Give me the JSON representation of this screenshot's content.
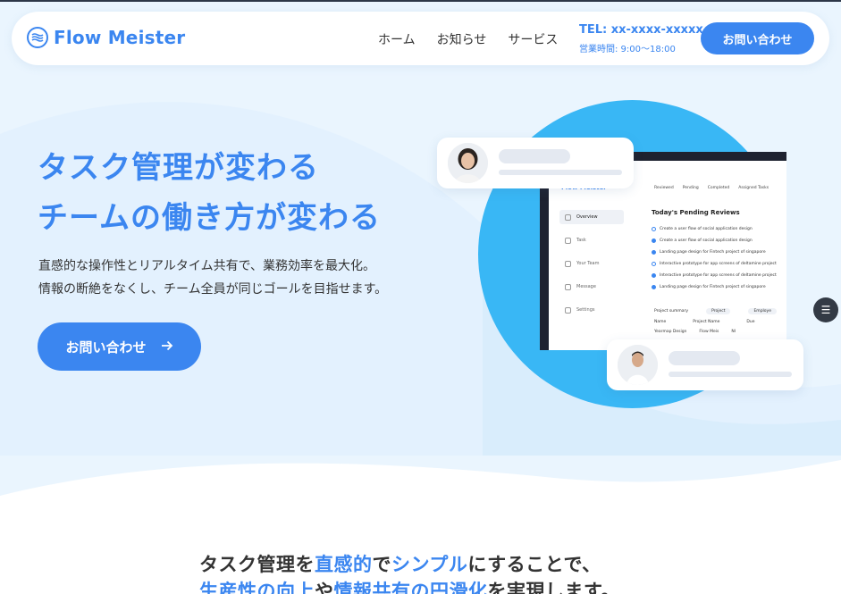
{
  "header": {
    "logo_text": "Flow Meister",
    "nav": [
      "ホーム",
      "お知らせ",
      "サービス"
    ],
    "tel": "TEL: xx-xxxx-xxxxx",
    "hours": "営業時間: 9:00〜18:00",
    "cta_label": "お問い合わせ"
  },
  "hero": {
    "title_line1": "タスク管理が変わる",
    "title_line2": "チームの働き方が変わる",
    "desc_line1": "直感的な操作性とリアルタイム共有で、業務効率を最大化。",
    "desc_line2": "情報の断絶をなくし、チーム全員が同じゴールを目指せます。",
    "cta_label": "お問い合わせ"
  },
  "mockup": {
    "app_name": "Flow Meister",
    "sidebar": [
      "Overview",
      "Task",
      "Your Team",
      "Message",
      "Settings"
    ],
    "tabs": [
      "Reviewed",
      "Pending",
      "Completed",
      "Assigned Tasks"
    ],
    "pending_title": "Today's Pending Reviews",
    "tasks": [
      "Create a user flow of social application design",
      "Create a user flow of social application design",
      "Landing page design for Fintech project of singapore",
      "Interactive prototype for app screens of deltamine project",
      "Interactive prototype for app screens of deltamine project",
      "Landing page design for Fintech project of singapore"
    ],
    "project_summary": "Project summary",
    "summary_filters": [
      "Project",
      "Employe"
    ],
    "summary_cols": [
      "Name",
      "Project Name",
      "Due"
    ],
    "summary_row": [
      "Yearmap Design",
      "Flow Meis",
      "Nl"
    ]
  },
  "section2": {
    "line1_parts": [
      "タスク管理を",
      "直感的",
      "で",
      "シンプル",
      "にすることで、"
    ],
    "line2_parts": [
      "生産性の向上",
      "や",
      "情報共有の円滑化",
      "を実現します。"
    ]
  },
  "colors": {
    "accent": "#3b86f0",
    "circle": "#39b7f5",
    "background": "#eaf5fe"
  }
}
